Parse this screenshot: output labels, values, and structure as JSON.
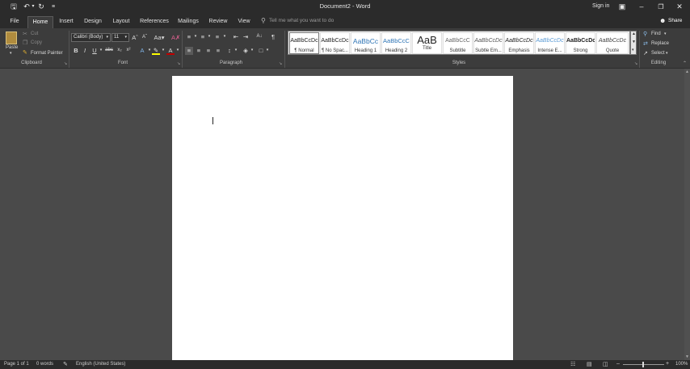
{
  "app": {
    "window_title": "Document2 - Word",
    "sign_in": "Sign in",
    "share": "Share"
  },
  "tabs": [
    "File",
    "Home",
    "Insert",
    "Design",
    "Layout",
    "References",
    "Mailings",
    "Review",
    "View"
  ],
  "tell_me": {
    "placeholder": "Tell me what you want to do"
  },
  "clipboard": {
    "paste": "Paste",
    "cut": "Cut",
    "copy": "Copy",
    "format_painter": "Format Painter",
    "label": "Clipboard"
  },
  "font": {
    "family": "Calibri (Body)",
    "size": "11",
    "label": "Font"
  },
  "paragraph": {
    "label": "Paragraph"
  },
  "styles": {
    "label": "Styles",
    "items": [
      {
        "preview": "AaBbCcDc",
        "name": "¶ Normal"
      },
      {
        "preview": "AaBbCcDc",
        "name": "¶ No Spac..."
      },
      {
        "preview": "AaBbCc",
        "name": "Heading 1"
      },
      {
        "preview": "AaBbCcC",
        "name": "Heading 2"
      },
      {
        "preview": "AaB",
        "name": "Title"
      },
      {
        "preview": "AaBbCcC",
        "name": "Subtitle"
      },
      {
        "preview": "AaBbCcDc",
        "name": "Subtle Em..."
      },
      {
        "preview": "AaBbCcDc",
        "name": "Emphasis"
      },
      {
        "preview": "AaBbCcDc",
        "name": "Intense E..."
      },
      {
        "preview": "AaBbCcDc",
        "name": "Strong"
      },
      {
        "preview": "AaBbCcDc",
        "name": "Quote"
      }
    ]
  },
  "editing": {
    "find": "Find",
    "replace": "Replace",
    "select": "Select",
    "label": "Editing"
  },
  "status": {
    "page": "Page 1 of 1",
    "words": "0 words",
    "language": "English (United States)",
    "zoom": "100%"
  },
  "colors": {
    "accent_font": "#c00000",
    "highlight": "#ffff00",
    "heading_blue": "#2e74b5"
  }
}
